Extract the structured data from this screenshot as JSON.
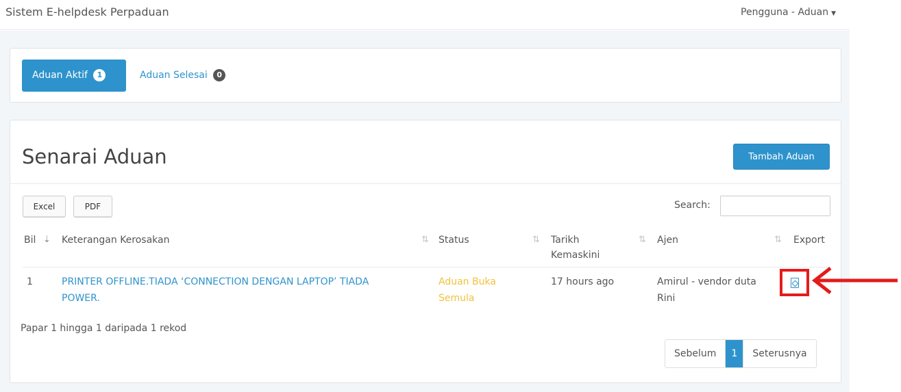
{
  "navbar": {
    "brand": "Sistem E-helpdesk Perpaduan",
    "user_menu": "Pengguna - Aduan"
  },
  "tabs": [
    {
      "label": "Aduan Aktif",
      "count": "1",
      "active": true
    },
    {
      "label": "Aduan Selesai",
      "count": "0",
      "active": false
    }
  ],
  "list": {
    "title": "Senarai Aduan",
    "add_button": "Tambah Aduan",
    "export_buttons": {
      "excel": "Excel",
      "pdf": "PDF"
    },
    "search_label": "Search:",
    "search_value": "",
    "columns": {
      "bil": "Bil",
      "keterangan": "Keterangan Kerosakan",
      "status": "Status",
      "tarikh_line1": "Tarikh",
      "tarikh_line2": "Kemaskini",
      "ajen": "Ajen",
      "export": "Export"
    },
    "rows": [
      {
        "bil": "1",
        "keterangan_line1": "PRINTER OFFLINE.TIADA ‘CONNECTION DENGAN LAPTOP’ TIADA",
        "keterangan_line2": "POWER.",
        "status_line1": "Aduan Buka",
        "status_line2": "Semula",
        "tarikh": "17 hours ago",
        "ajen_line1": "Amirul - vendor duta",
        "ajen_line2": "Rini",
        "export_icon": "file-pdf-icon"
      }
    ],
    "info": "Papar 1 hingga 1 daripada 1 rekod",
    "pagination": {
      "prev": "Sebelum",
      "current": "1",
      "next": "Seterusnya"
    }
  },
  "colors": {
    "primary": "#2e93cc",
    "status_warning": "#f0c23b",
    "annotation": "#e41b1b",
    "background": "#f3f6f8"
  }
}
